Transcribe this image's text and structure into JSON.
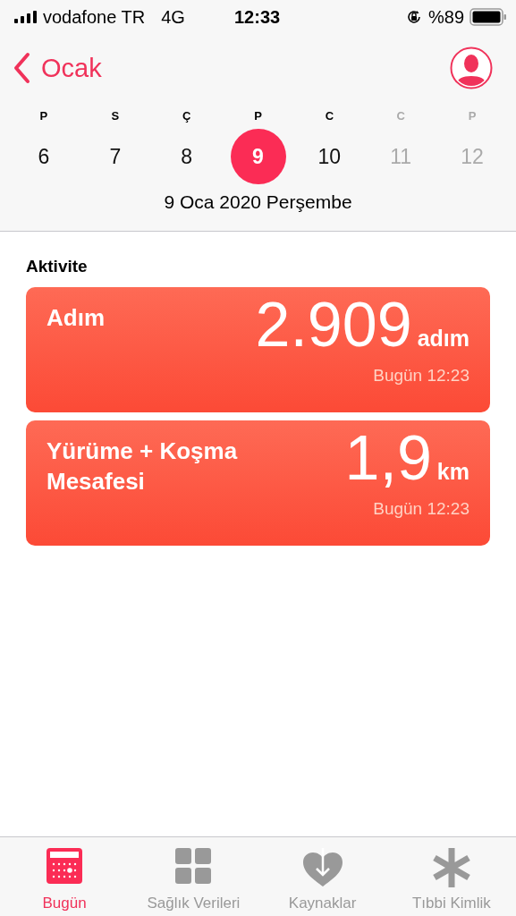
{
  "status_bar": {
    "carrier": "vodafone TR",
    "network": "4G",
    "time": "12:33",
    "battery": "%89"
  },
  "nav": {
    "back": "Ocak"
  },
  "week": [
    {
      "letter": "P",
      "day": "6",
      "selected": false,
      "disabled": false
    },
    {
      "letter": "S",
      "day": "7",
      "selected": false,
      "disabled": false
    },
    {
      "letter": "Ç",
      "day": "8",
      "selected": false,
      "disabled": false
    },
    {
      "letter": "P",
      "day": "9",
      "selected": true,
      "disabled": false
    },
    {
      "letter": "C",
      "day": "10",
      "selected": false,
      "disabled": false
    },
    {
      "letter": "C",
      "day": "11",
      "selected": false,
      "disabled": true
    },
    {
      "letter": "P",
      "day": "12",
      "selected": false,
      "disabled": true
    }
  ],
  "date_label": "9 Oca 2020 Perşembe",
  "section": "Aktivite",
  "cards": [
    {
      "title": "Adım",
      "value": "2.909",
      "unit": "adım",
      "time": "Bugün 12:23"
    },
    {
      "title": "Yürüme + Koşma Mesafesi",
      "value": "1,9",
      "unit": "km",
      "time": "Bugün 12:23"
    }
  ],
  "tabs": [
    {
      "label": "Bugün",
      "selected": true
    },
    {
      "label": "Sağlık Verileri",
      "selected": false
    },
    {
      "label": "Kaynaklar",
      "selected": false
    },
    {
      "label": "Tıbbi Kimlik",
      "selected": false
    }
  ]
}
